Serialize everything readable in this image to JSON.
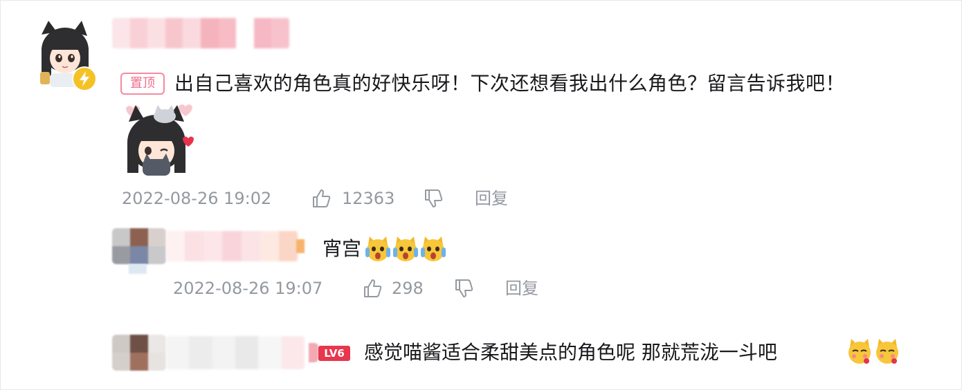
{
  "top_comment": {
    "pin_label": "置顶",
    "text": "出自己喜欢的角色真的好快乐呀！下次还想看我出什么角色？留言告诉我吧！",
    "timestamp": "2022-08-26 19:02",
    "like_count": "12363",
    "reply_label": "回复",
    "icons": {
      "like": "thumbs-up-icon",
      "dislike": "thumbs-down-icon",
      "verified": "lightning-verified-icon"
    }
  },
  "replies": [
    {
      "text": "宵宫",
      "emoji": "surprised-cat-emoji",
      "emoji_count": 3,
      "timestamp": "2022-08-26 19:07",
      "like_count": "298",
      "reply_label": "回复"
    },
    {
      "level_badge": "LV6",
      "text": "感觉喵酱适合柔甜美点的角色呢 那就荒泷一斗吧",
      "emoji": "flushed-cat-emoji",
      "emoji_count": 2
    }
  ],
  "colors": {
    "accent_pink": "#f06d8b",
    "meta_gray": "#9499a0",
    "level_red": "#e8364d",
    "text": "#18191c"
  }
}
